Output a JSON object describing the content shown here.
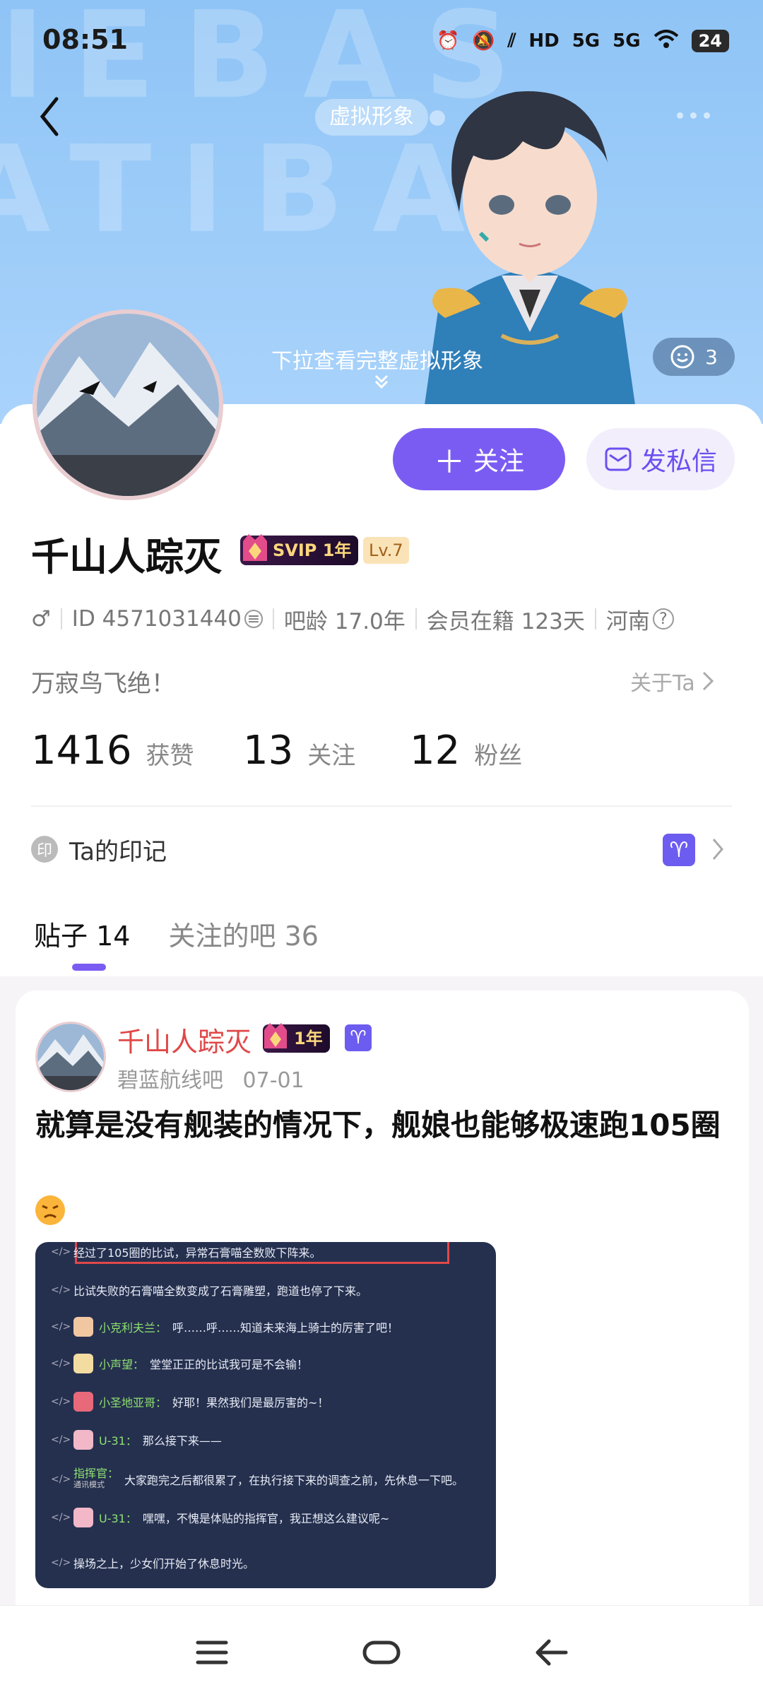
{
  "status_bar": {
    "time": "08:51",
    "network_1": "HD",
    "network_2": "5G",
    "network_3": "5G",
    "battery": "24"
  },
  "header": {
    "avatar_chip": "虚拟形象",
    "pull_hint": "下拉查看完整虚拟形象",
    "like_count": "3"
  },
  "profile": {
    "follow_label": "关注",
    "message_label": "发私信",
    "username": "千山人踪灭",
    "svip_label": "SVIP 1年",
    "level_label": "Lv.7",
    "id": "ID 4571031440",
    "bar_age": "吧龄 17.0年",
    "member_days": "会员在籍 123天",
    "location": "河南",
    "signature": "万寂鸟飞绝！",
    "about_link": "关于Ta",
    "stats": [
      {
        "value": "1416",
        "label": "获赞"
      },
      {
        "value": "13",
        "label": "关注"
      },
      {
        "value": "12",
        "label": "粉丝"
      }
    ],
    "marks_icon": "印",
    "marks_label": "Ta的印记",
    "aries_symbol": "♈"
  },
  "tabs": {
    "posts_label": "贴子",
    "posts_count": "14",
    "bars_label": "关注的吧",
    "bars_count": "36"
  },
  "post": {
    "author": "千山人踪灭",
    "vip_label": "1年",
    "aries_symbol": "♈",
    "bar_name": "碧蓝航线吧",
    "date": "07-01",
    "title": "就算是没有舰装的情况下，舰娘也能够极速跑105圈",
    "image_lines": [
      {
        "speaker": "",
        "text": "经过了105圈的比试，异常石膏喵全数败下阵来。"
      },
      {
        "speaker": "",
        "text": "比试失败的石膏喵全数变成了石膏雕塑，跑道也停了下来。"
      },
      {
        "speaker": "小克利夫兰：",
        "text": "呼……呼……知道未来海上骑士的厉害了吧！"
      },
      {
        "speaker": "小声望：",
        "text": "堂堂正正的比试我可是不会输！"
      },
      {
        "speaker": "小圣地亚哥：",
        "text": "好耶！果然我们是最厉害的~！"
      },
      {
        "speaker": "U-31：",
        "text": "那么接下来——"
      },
      {
        "speaker": "指挥官：",
        "text": "大家跑完之后都很累了，在执行接下来的调查之前，先休息一下吧。"
      },
      {
        "speaker": "U-31：",
        "text": "嘿嘿，不愧是体贴的指挥官，我正想这么建议呢~"
      },
      {
        "speaker": "",
        "text": "操场之上，少女们开始了休息时光。"
      }
    ],
    "image_sub_caption": "通讯模式",
    "line_tag": "</>"
  },
  "colors": {
    "accent": "#7b5cf3",
    "header_bg": "#9fcdf8",
    "author_red": "#e04848"
  }
}
